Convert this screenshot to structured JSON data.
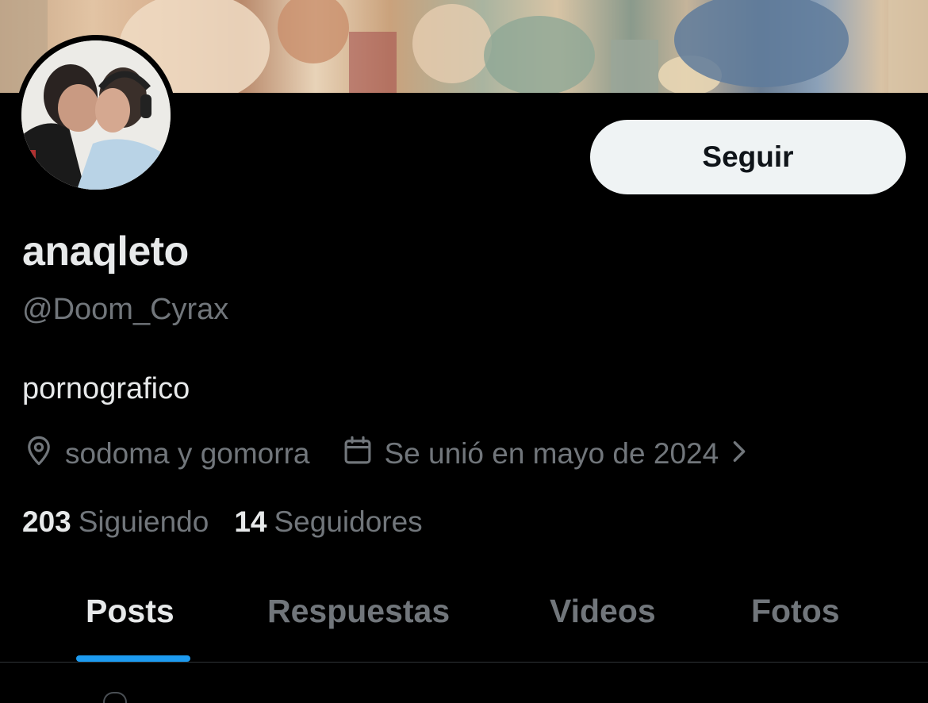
{
  "profile": {
    "display_name": "anaqleto",
    "handle": "@Doom_Cyrax",
    "bio": "pornografico",
    "location": "sodoma y gomorra",
    "joined": "Se unió en mayo de 2024"
  },
  "actions": {
    "follow_label": "Seguir"
  },
  "stats": {
    "following_count": "203",
    "following_label": "Siguiendo",
    "followers_count": "14",
    "followers_label": "Seguidores"
  },
  "tabs": [
    {
      "label": "Posts",
      "active": true
    },
    {
      "label": "Respuestas",
      "active": false
    },
    {
      "label": "Videos",
      "active": false
    },
    {
      "label": "Fotos",
      "active": false
    }
  ],
  "icons": {
    "location": "location-pin-icon",
    "calendar": "calendar-icon",
    "chevron": "chevron-right-icon"
  },
  "colors": {
    "background": "#000000",
    "primary_text": "#e7e9ea",
    "secondary_text": "#71767b",
    "accent": "#1d9bf0",
    "button_bg": "#eff3f4"
  }
}
